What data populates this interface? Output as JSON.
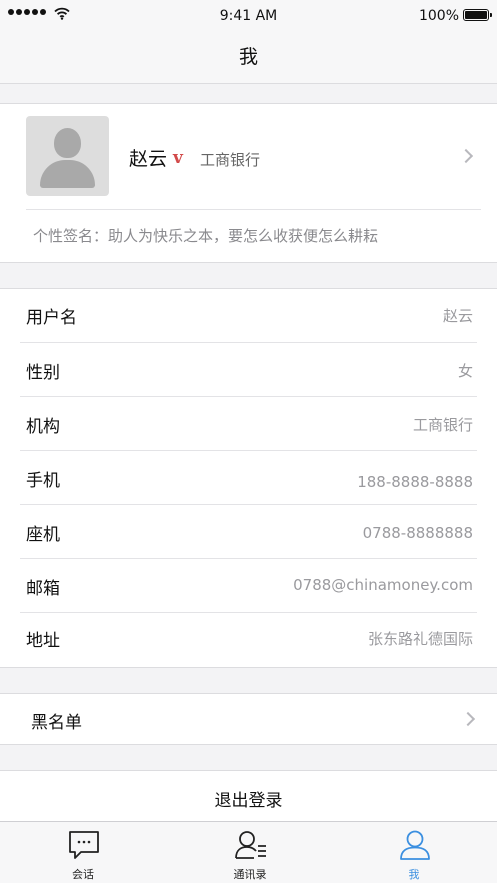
{
  "status_bar": {
    "time": "9:41 AM",
    "battery": "100%"
  },
  "nav": {
    "title": "我"
  },
  "profile": {
    "name": "赵云",
    "badge": "v",
    "org": "工商银行",
    "signature": "个性签名：助人为快乐之本，要怎么收获便怎么耕耘"
  },
  "info": [
    {
      "label": "用户名",
      "value": "赵云"
    },
    {
      "label": "性别",
      "value": "女"
    },
    {
      "label": "机构",
      "value": "工商银行"
    },
    {
      "label": "手机",
      "value": "188-8888-8888"
    },
    {
      "label": "座机",
      "value": "0788-8888888"
    },
    {
      "label": "邮箱",
      "value": "0788@chinamoney.com"
    },
    {
      "label": "地址",
      "value": "张东路礼德国际"
    }
  ],
  "blacklist": {
    "label": "黑名单"
  },
  "logout": {
    "label": "退出登录"
  },
  "tabs": [
    {
      "label": "会话",
      "icon": "chat-icon"
    },
    {
      "label": "通讯录",
      "icon": "contacts-icon"
    },
    {
      "label": "我",
      "icon": "person-icon"
    }
  ],
  "colors": {
    "accent": "#3b8fe0",
    "vip_badge": "#d24a4a"
  }
}
